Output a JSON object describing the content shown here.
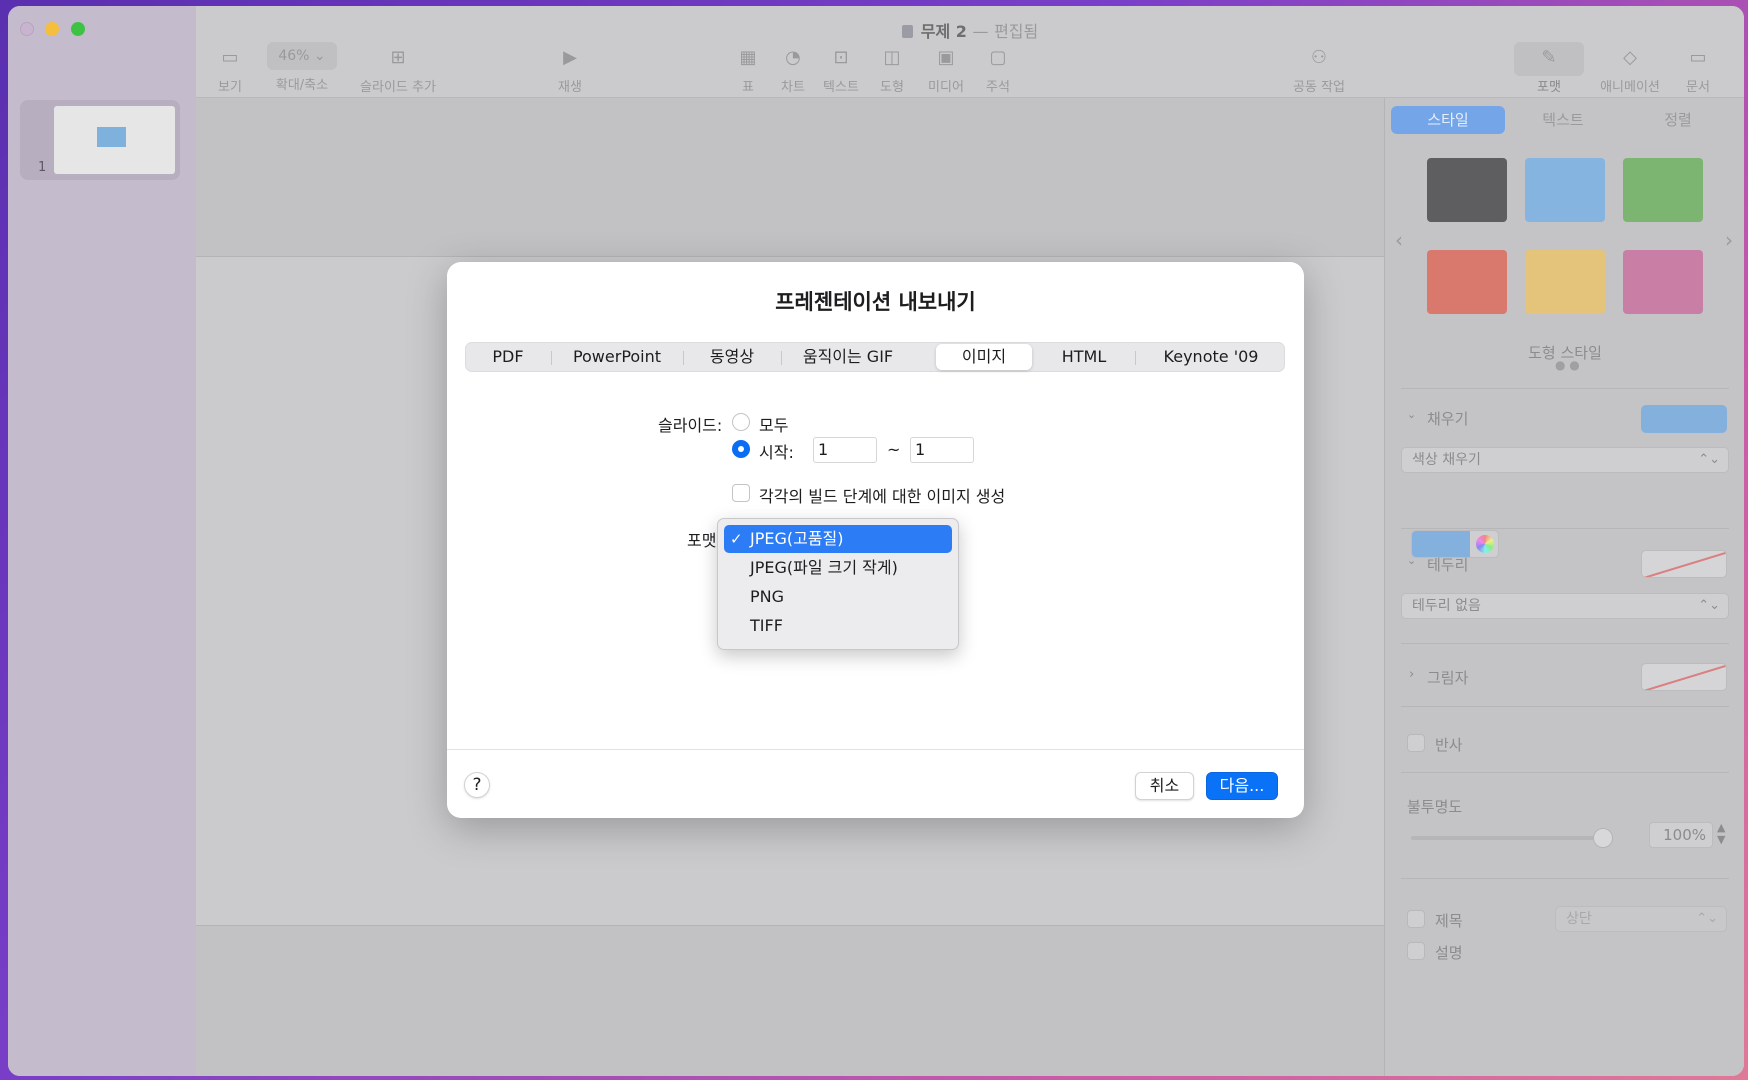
{
  "window": {
    "title": "무제 2",
    "title_sep": "—",
    "edited": "편집됨"
  },
  "toolbar": {
    "view": "보기",
    "zoom_value": "46%",
    "zoom": "확대/축소",
    "add_slide": "슬라이드 추가",
    "play": "재생",
    "table": "표",
    "chart": "차트",
    "text": "텍스트",
    "shape": "도형",
    "media": "미디어",
    "comment": "주석",
    "collaborate": "공동 작업",
    "format": "포맷",
    "animate": "애니메이션",
    "document": "문서"
  },
  "sidebar": {
    "slide_number": "1"
  },
  "inspector": {
    "tabs": [
      "스타일",
      "텍스트",
      "정렬"
    ],
    "swatch_colors": [
      "#5e5e60",
      "#86b4e0",
      "#7cb472",
      "#d9786c",
      "#e4c47a",
      "#c97ea6"
    ],
    "shape_styles": "도형 스타일",
    "fill": "채우기",
    "fill_type": "색상 채우기",
    "border": "테두리",
    "border_type": "테두리 없음",
    "shadow": "그림자",
    "reflection": "반사",
    "opacity": "불투명도",
    "opacity_value": "100%",
    "title_label": "제목",
    "title_position": "상단",
    "caption": "설명"
  },
  "dialog": {
    "title": "프레젠테이션 내보내기",
    "tabs": [
      "PDF",
      "PowerPoint",
      "동영상",
      "움직이는 GIF",
      "이미지",
      "HTML",
      "Keynote '09"
    ],
    "active_tab": "이미지",
    "slides_label": "슬라이드:",
    "radio_all": "모두",
    "radio_from": "시작:",
    "from_value": "1",
    "range_sep": "~",
    "to_value": "1",
    "build_checkbox": "각각의 빌드 단계에 대한 이미지 생성",
    "format_label": "포맷",
    "format_options": [
      "JPEG(고품질)",
      "JPEG(파일 크기 작게)",
      "PNG",
      "TIFF"
    ],
    "selected_format": "JPEG(고품질)",
    "check_mark": "✓",
    "help": "?",
    "cancel": "취소",
    "next": "다음..."
  },
  "colors": {
    "accent": "#0a72f7",
    "menu_selected": "#2c7cf6"
  }
}
